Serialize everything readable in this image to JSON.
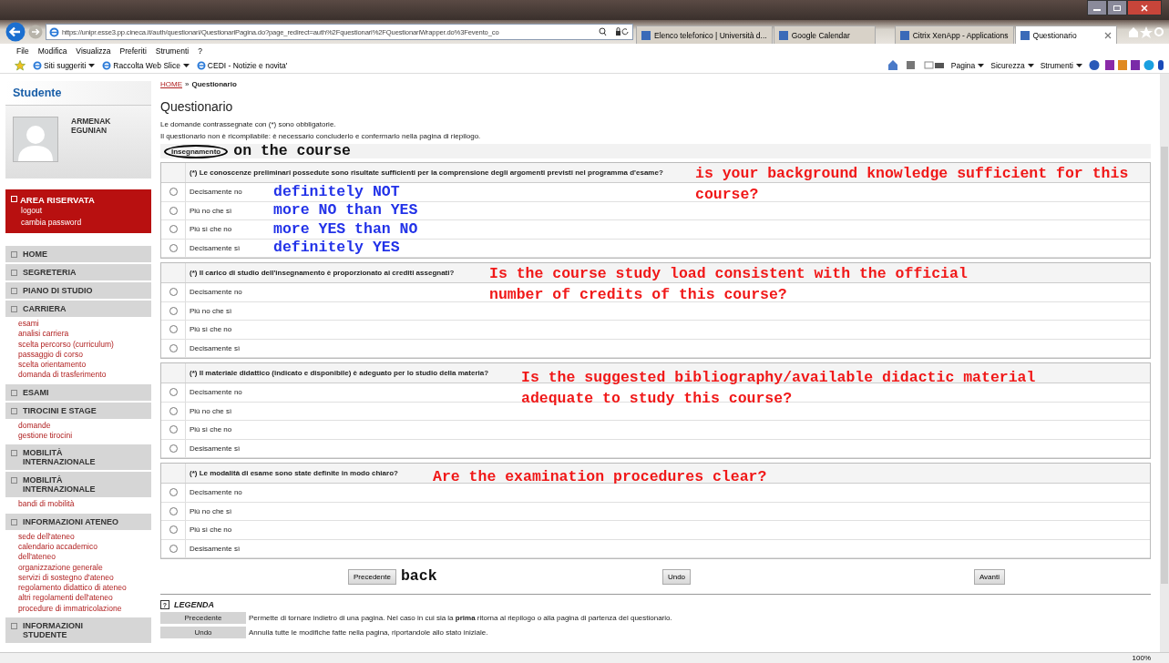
{
  "browser": {
    "address": "https://unipr.esse3.pp.cineca.it/auth/questionari/QuestionariPagina.do?page_redirect=auth%2Fquestionari%2FQuestionariWrapper.do%3Fevento_co",
    "tabs": [
      {
        "label": "Elenco telefonico | Università d...",
        "selected": false
      },
      {
        "label": "Google Calendar",
        "selected": false
      },
      {
        "label": "Citrix XenApp - Applications",
        "selected": false
      },
      {
        "label": "Questionario",
        "selected": true
      }
    ],
    "menu": [
      "File",
      "Modifica",
      "Visualizza",
      "Preferiti",
      "Strumenti",
      "?"
    ],
    "favorites": [
      "Siti suggeriti",
      "Raccolta Web Slice",
      "CEDI - Notizie e novita'"
    ],
    "commands": [
      "Pagina",
      "Sicurezza",
      "Strumenti"
    ],
    "zoom": "100%"
  },
  "sidebar": {
    "heading": "Studente",
    "user": "ARMENAK EGUNIAN",
    "reserved": {
      "title": "AREA RISERVATA",
      "links": [
        "logout",
        "cambia password"
      ]
    },
    "sections": [
      {
        "title": "HOME"
      },
      {
        "title": "SEGRETERIA"
      },
      {
        "title": "PIANO DI STUDIO"
      },
      {
        "title": "CARRIERA",
        "links": [
          "esami",
          "analisi carriera",
          "scelta percorso (curriculum)",
          "passaggio di corso",
          "scelta orientamento",
          "domanda di trasferimento"
        ]
      },
      {
        "title": "ESAMI"
      },
      {
        "title": "TIROCINI E STAGE",
        "links": [
          "domande",
          "gestione tirocini"
        ]
      },
      {
        "title": "MOBILITÀ INTERNAZIONALE"
      },
      {
        "title": "MOBILITÀ INTERNAZIONALE",
        "links": [
          "bandi di mobilità"
        ]
      },
      {
        "title": "INFORMAZIONI ATENEO",
        "links": [
          "sede dell'ateneo",
          "calendario accademico dell'ateneo",
          "organizzazione generale",
          "servizi di sostegno d'ateneo",
          "regolamento didattico di ateneo",
          "altri regolamenti dell'ateneo",
          "procedure di immatricolazione"
        ]
      },
      {
        "title": "INFORMAZIONI STUDENTE"
      }
    ]
  },
  "main": {
    "breadcrumb": {
      "link": "HOME",
      "separator": "»",
      "current": "Questionario"
    },
    "title": "Questionario",
    "notes": [
      "Le domande contrassegnate con (*) sono obbligatorie.",
      "Il questionario non è ricompilabile: è necessario concluderlo e confermarlo nella pagina di riepilogo."
    ],
    "section": {
      "label": "Insegnamento",
      "annotation": "on the course"
    },
    "questions": [
      {
        "text": "(*) Le conoscenze preliminari possedute sono risultate sufficienti per la comprensione degli argomenti previsti nel programma d'esame?",
        "annotation": "is your background knowledge sufficient for this course?",
        "options": [
          {
            "label": "Decisamente no",
            "selected": false,
            "annotation": "definitely NOT"
          },
          {
            "label": "Più no che sì",
            "selected": false,
            "annotation": "more NO than YES"
          },
          {
            "label": "Più sì che no",
            "selected": false,
            "annotation": "more YES than NO"
          },
          {
            "label": "Decisamente sì",
            "selected": false,
            "annotation": "definitely YES"
          }
        ]
      },
      {
        "text": "(*) Il carico di studio dell'insegnamento è proporzionato ai crediti assegnati?",
        "annotation": "Is the course study load consistent with the official number of credits of this course?",
        "options": [
          {
            "label": "Decisamente no",
            "selected": false
          },
          {
            "label": "Più no che sì",
            "selected": false
          },
          {
            "label": "Più sì che no",
            "selected": false
          },
          {
            "label": "Decisamente sì",
            "selected": false
          }
        ]
      },
      {
        "text": "(*) Il materiale didattico (indicato e disponibile) è adeguato per lo studio della materia?",
        "annotation": "Is the suggested bibliography/available didactic material adequate to study this course?",
        "options": [
          {
            "label": "Decisamente no",
            "selected": false
          },
          {
            "label": "Più no che sì",
            "selected": false
          },
          {
            "label": "Più sì che no",
            "selected": false
          },
          {
            "label": "Desisamente sì",
            "selected": false
          }
        ]
      },
      {
        "text": "(*) Le modalità di esame sono state definite in modo chiaro?",
        "annotation": "Are the examination procedures clear?",
        "options": [
          {
            "label": "Decisamente no",
            "selected": false
          },
          {
            "label": "Più no che sì",
            "selected": false
          },
          {
            "label": "Più sì che no",
            "selected": false
          },
          {
            "label": "Desisamente sì",
            "selected": false
          }
        ]
      }
    ],
    "buttons": [
      {
        "label": "Precedente",
        "annotation": "back"
      },
      {
        "label": "Undo"
      },
      {
        "label": "Avanti"
      }
    ],
    "legend": {
      "icon": "?",
      "title": "LEGENDA",
      "rows": [
        {
          "button": "Precedente",
          "description": "Permette di tornare indietro di una pagina. Nel caso in cui sia la **prima** ritorna al riepilogo o alla pagina di partenza del questionario."
        },
        {
          "button": "Undo",
          "description": "Annulla tutte le modifiche fatte nella pagina, riportandole allo stato iniziale."
        }
      ]
    }
  }
}
